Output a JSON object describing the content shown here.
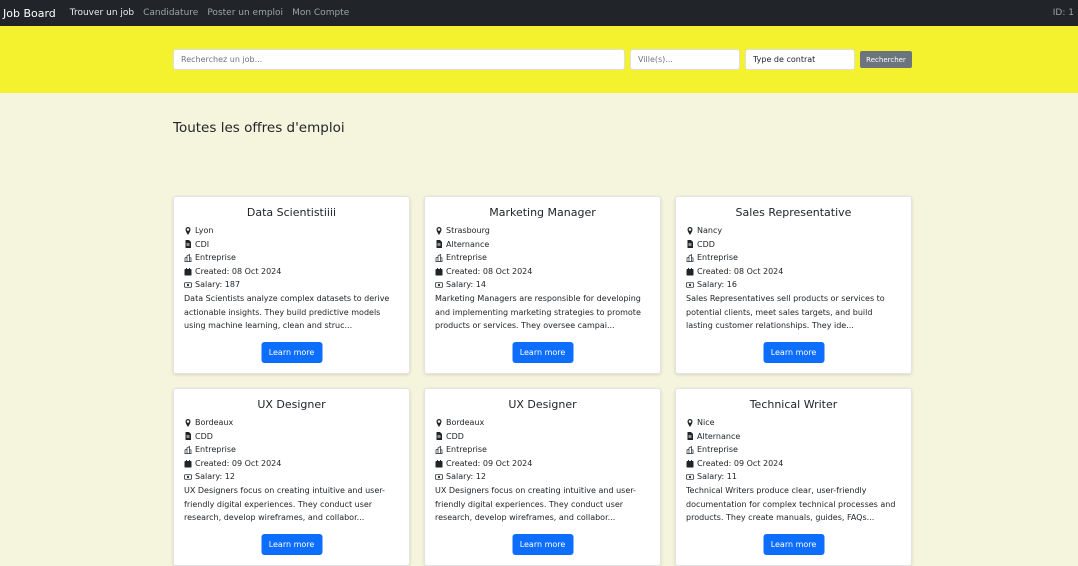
{
  "navbar": {
    "brand": "Job Board",
    "links": [
      "Trouver un job",
      "Candidature",
      "Poster un emploi",
      "Mon Compte"
    ],
    "id_label": "ID: 1"
  },
  "search": {
    "job_placeholder": "Recherchez un job...",
    "city_placeholder": "Ville(s)...",
    "contract_label": "Type de contrat",
    "button_label": "Rechercher"
  },
  "main": {
    "title": "Toutes les offres d'emploi",
    "learn_more_label": "Learn more",
    "jobs": [
      {
        "title": "Data Scientistiiii",
        "city": "Lyon",
        "contract": "CDI",
        "type": "Entreprise",
        "created": "Created: 08 Oct 2024",
        "salary": "Salary: 187",
        "description": "Data Scientists analyze complex datasets to derive actionable insights. They build predictive models using machine learning, clean and struc..."
      },
      {
        "title": "Marketing Manager",
        "city": "Strasbourg",
        "contract": "Alternance",
        "type": "Entreprise",
        "created": "Created: 08 Oct 2024",
        "salary": "Salary: 14",
        "description": "Marketing Managers are responsible for developing and implementing marketing strategies to promote products or services. They oversee campai..."
      },
      {
        "title": "Sales Representative",
        "city": "Nancy",
        "contract": "CDD",
        "type": "Entreprise",
        "created": "Created: 08 Oct 2024",
        "salary": "Salary: 16",
        "description": "Sales Representatives sell products or services to potential clients, meet sales targets, and build lasting customer relationships. They ide..."
      },
      {
        "title": "UX Designer",
        "city": "Bordeaux",
        "contract": "CDD",
        "type": "Entreprise",
        "created": "Created: 09 Oct 2024",
        "salary": "Salary: 12",
        "description": "UX Designers focus on creating intuitive and user-friendly digital experiences. They conduct user research, develop wireframes, and collabor..."
      },
      {
        "title": "UX Designer",
        "city": "Bordeaux",
        "contract": "CDD",
        "type": "Entreprise",
        "created": "Created: 09 Oct 2024",
        "salary": "Salary: 12",
        "description": "UX Designers focus on creating intuitive and user-friendly digital experiences. They conduct user research, develop wireframes, and collabor..."
      },
      {
        "title": "Technical Writer",
        "city": "Nice",
        "contract": "Alternance",
        "type": "Entreprise",
        "created": "Created: 09 Oct 2024",
        "salary": "Salary: 11",
        "description": "Technical Writers produce clear, user-friendly documentation for complex technical processes and products. They create manuals, guides, FAQs..."
      }
    ]
  },
  "icons": {
    "city": "map-pin-icon",
    "contract": "document-icon",
    "type": "building-icon",
    "created": "calendar-icon",
    "salary": "cash-icon"
  },
  "colors": {
    "navbar_bg": "#212529",
    "search_band_bg": "#f4f22e",
    "page_bg": "#f5f4dc",
    "primary_button": "#0d6efd",
    "secondary_button": "#6c757d"
  }
}
